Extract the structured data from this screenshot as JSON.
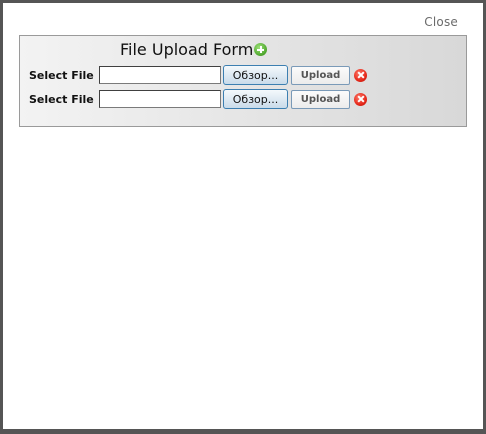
{
  "dialog": {
    "close_label": "Close"
  },
  "form": {
    "title": "File Upload Form",
    "add_icon": "add-circle-icon",
    "rows": [
      {
        "label": "Select File",
        "file_value": "",
        "browse_label": "Обзор...",
        "upload_label": "Upload",
        "remove_icon": "remove-circle-icon"
      },
      {
        "label": "Select File",
        "file_value": "",
        "browse_label": "Обзор...",
        "upload_label": "Upload",
        "remove_icon": "remove-circle-icon"
      }
    ]
  },
  "colors": {
    "window_border": "#555555",
    "panel_gradient_start": "#f3f3f3",
    "panel_gradient_end": "#d8d8d8",
    "add_icon": "#4da52c",
    "remove_icon": "#e5281a"
  }
}
